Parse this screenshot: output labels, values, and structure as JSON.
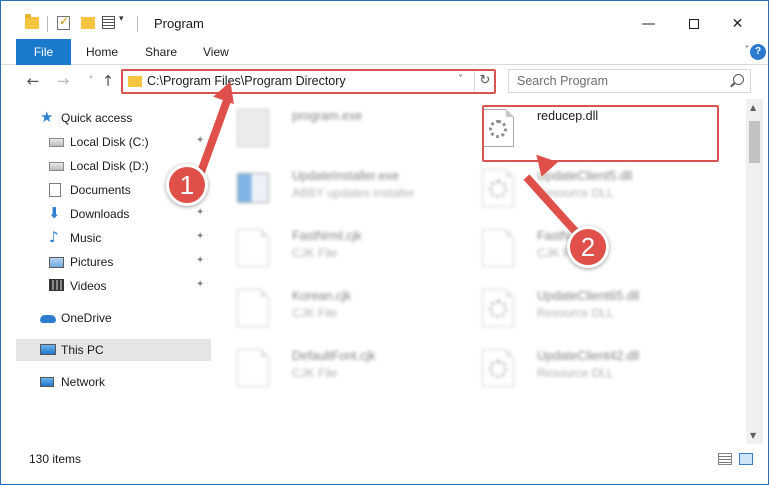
{
  "window": {
    "title": "Program",
    "minimize_glyph": "—",
    "close_glyph": "✕"
  },
  "ribbon": {
    "tabs": [
      "File",
      "Home",
      "Share",
      "View"
    ]
  },
  "address_bar": {
    "path": "C:\\Program Files\\Program Directory"
  },
  "search": {
    "placeholder": "Search Program"
  },
  "nav_pane": {
    "items": [
      {
        "label": "Quick access",
        "icon": "star-icon"
      },
      {
        "label": "Local Disk (C:)",
        "icon": "disk-icon"
      },
      {
        "label": "Local Disk (D:)",
        "icon": "disk-icon"
      },
      {
        "label": "Documents",
        "icon": "documents-icon"
      },
      {
        "label": "Downloads",
        "icon": "download-icon"
      },
      {
        "label": "Music",
        "icon": "music-icon"
      },
      {
        "label": "Pictures",
        "icon": "pictures-icon"
      },
      {
        "label": "Videos",
        "icon": "videos-icon"
      },
      {
        "label": "OneDrive",
        "icon": "cloud-icon"
      },
      {
        "label": "This PC",
        "icon": "computer-icon"
      },
      {
        "label": "Network",
        "icon": "network-icon"
      }
    ]
  },
  "files": [
    {
      "name": "program.exe",
      "type": "",
      "icon": "exe-icon"
    },
    {
      "name": "reducep.dll",
      "type": "",
      "icon": "dll-gear-icon"
    },
    {
      "name": "UpdateInstaller.exe",
      "type": "ABBY updates installer",
      "icon": "installer-icon"
    },
    {
      "name": "UpdateClient5.dll",
      "type": "Resource DLL",
      "icon": "dll-gear-icon"
    },
    {
      "name": "FastNrml.cjk",
      "type": "CJK File",
      "icon": "document-icon"
    },
    {
      "name": "FastN...",
      "type": "CJK File",
      "icon": "document-icon"
    },
    {
      "name": "Korean.cjk",
      "type": "CJK File",
      "icon": "document-icon"
    },
    {
      "name": "UpdateClient65.dll",
      "type": "Resource DLL",
      "icon": "dll-gear-icon"
    },
    {
      "name": "DefaultFont.cjk",
      "type": "CJK File",
      "icon": "document-icon"
    },
    {
      "name": "UpdateClient42.dll",
      "type": "Resource DLL",
      "icon": "dll-gear-icon"
    }
  ],
  "status": {
    "item_count": "130 items"
  },
  "annotations": {
    "step1": "1",
    "step2": "2",
    "color": "#e0504a"
  }
}
